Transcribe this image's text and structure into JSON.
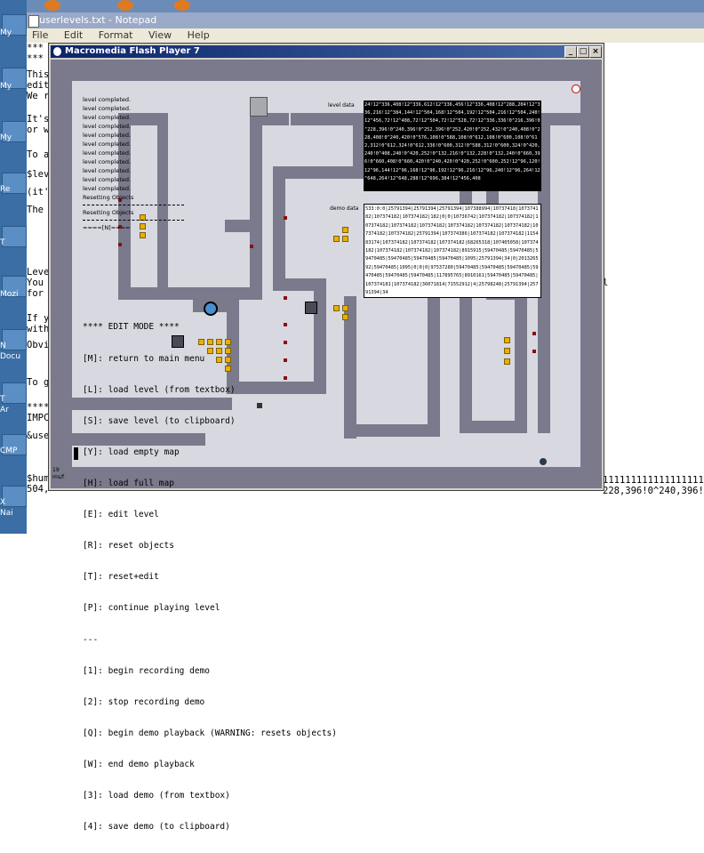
{
  "notepad": {
    "title": "userlevels.txt - Notepad",
    "menu": [
      "File",
      "Edit",
      "Format",
      "View",
      "Help"
    ],
    "lines": [
      {
        "text": "***"
      },
      {
        "text": "***"
      },
      {
        "text": "This"
      },
      {
        "text": "edit"
      },
      {
        "text": "We r"
      },
      {
        "text": "It's"
      },
      {
        "text": "or w"
      },
      {
        "text": "To a"
      },
      {
        "text": "$lev"
      },
      {
        "text": "(it'"
      },
      {
        "text": "The"
      },
      {
        "text": "Leve"
      },
      {
        "text": "You"
      },
      {
        "text": "for"
      },
      {
        "text": "If y"
      },
      {
        "text": "with"
      },
      {
        "text": "Obvi"
      },
      {
        "text": "To g"
      },
      {
        "text": "****"
      },
      {
        "text": "IMPC"
      },
      {
        "text": "&use"
      },
      {
        "text": "$hum"
      },
      {
        "text": "504,"
      }
    ],
    "right_line_1": "l",
    "bottom_line_1": "11111111111111111100",
    "bottom_line_2": "228,396!0^240,396!"
  },
  "desktop_labels": [
    "My",
    "My",
    "My",
    "Re",
    "T",
    "Mozi",
    "N",
    "Docu",
    "T",
    "Ar",
    "CMP",
    "X",
    "Nai"
  ],
  "flash": {
    "title": "Macromedia Flash Player 7",
    "buttons": [
      "_",
      "□",
      "×"
    ],
    "log": [
      "level completed.",
      "level completed.",
      "level completed.",
      "level completed.",
      "level completed.",
      "level completed.",
      "level completed.",
      "level completed.",
      "level completed.",
      "level completed.",
      "level completed.",
      "Resetting Objects",
      "Resetting Objects",
      "====[N]===="
    ],
    "menu": [
      "**** EDIT MODE ****",
      "[M]: return to main menu",
      "[L]: load level (from textbox)",
      "[S]: save level (to clipboard)",
      "[Y]: load empty map",
      "[H]: load full map",
      "[E]: edit level",
      "[R]: reset objects",
      "[T]: reset+edit",
      "[P]: continue playing level",
      "---",
      "[1]: begin recording demo",
      "[2]: stop recording demo",
      "[Q]: begin demo playback (WARNING: resets objects)",
      "[W]: end demo playback",
      "[3]: load demo (from textbox)",
      "[4]: save demo (to clipboard)"
    ],
    "level_data_label": "level data",
    "level_data": "24!12^336,408!12^336,612!12^336,456!12^336,408!12^288,204!12^336,216!12^384,144!12^504,168!12^504,192!12^504,216!12^504,240!12^456,72!12^408,72!12^504,72!12^528,72!12^336,336!0^216,396!0^228,396!0^240,396!0^252,396!0^252,420!0^252,432!0^240,408!0^228,408!0^240,420!0^576,108!0^588,108!0^612,108!0^600,108!0^612,312!0^612,324!0^612,336!0^600,312!0^588,312!0^600,324!0^420,240!0^408,240!0^420,252!0^132,216!0^132,228!0^132,240!0^660,396!0^660,408!0^660,420!0^240,420!0^420,252!0^600,252!12^96,120!12^96,144!12^96,168!12^96,192!12^96,216!12^96,240!12^96,264!12^648,264!12^648,288!12^696,384!12^456,408",
    "demo_data_label": "demo data",
    "demo_data": "533:0:0|25791394|25791394|25791394|107388994|10737418|107374182|107374182|107374182|182|0|0|10736742|107374182|107374182|107374182|107374182|107374182|107374182|107374182|107374182|107374182|107374182|25791394|107374386|107374182|107374182|115483174|107374182|107374182|107374182|68265318|107405058|107374182|107374182|107374182|107374182|8915915|59470485|59470485|59470485|59470485|59470485|59470485|1095|25791394|34|0|201326592|59470485|1095|0|0|0|97537280|59470485|59470485|59470485|59470485|59470485|59470485|117895765|8910161|59470485|59470485|107374181|107374182|36071814|71552912|4|25798248|25791394|25791394|34",
    "fps": "19",
    "ms_label": "ms/f"
  }
}
